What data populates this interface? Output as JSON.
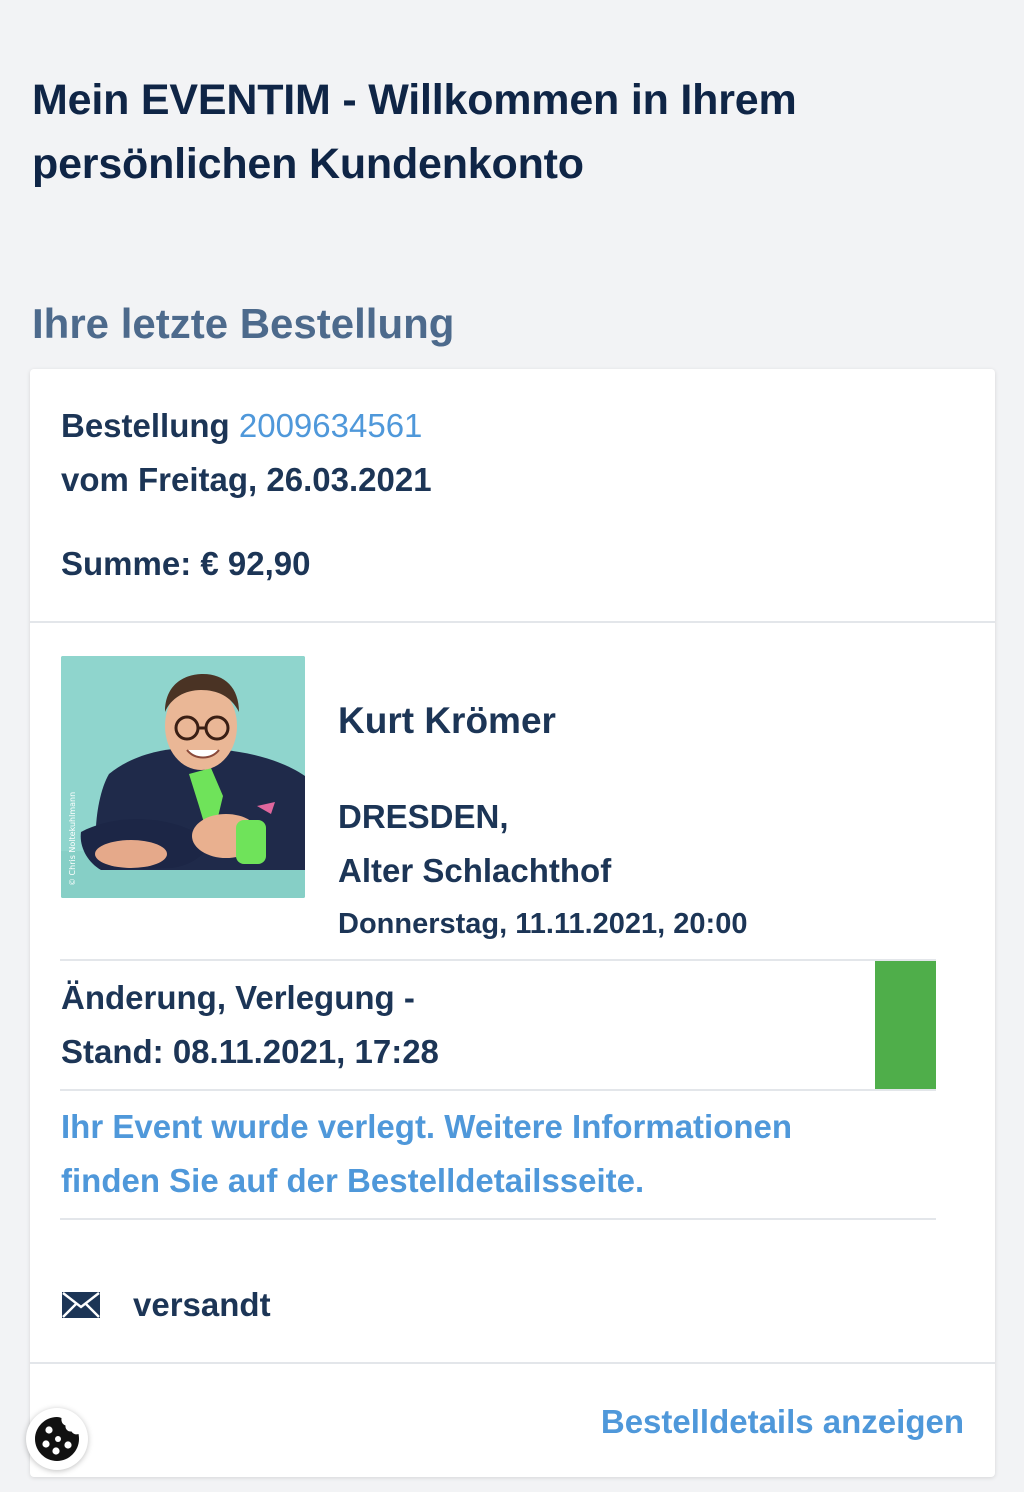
{
  "page": {
    "title_line1": "Mein EVENTIM - Willkommen in Ihrem",
    "title_line2": "persönlichen Kundenkonto",
    "section_heading": "Ihre letzte Bestellung"
  },
  "order": {
    "label": "Bestellung",
    "number": "2009634561",
    "date_line": "vom Freitag, 26.03.2021",
    "sum": "Summe: € 92,90"
  },
  "event": {
    "image_credit": "© Chris Noltekuhlmann",
    "title": "Kurt Krömer",
    "city": "DRESDEN,",
    "venue": "Alter Schlachthof",
    "datetime": "Donnerstag, 11.11.2021, 20:00"
  },
  "status": {
    "line1": "Änderung, Verlegung -",
    "line2": "Stand: 08.11.2021, 17:28",
    "color": "#4fae4a"
  },
  "notice": {
    "line1": "Ihr Event wurde verlegt. Weitere Informationen",
    "line2": "finden Sie auf der Bestelldetailsseite."
  },
  "shipping": {
    "icon": "envelope-icon",
    "label": "versandt"
  },
  "footer": {
    "details_link": "Bestelldetails anzeigen"
  },
  "cookie": {
    "icon": "cookie-icon"
  },
  "colors": {
    "primary_text": "#1c3556",
    "link": "#4f98da",
    "section_heading": "#4d6a8c",
    "background": "#f2f3f5"
  }
}
